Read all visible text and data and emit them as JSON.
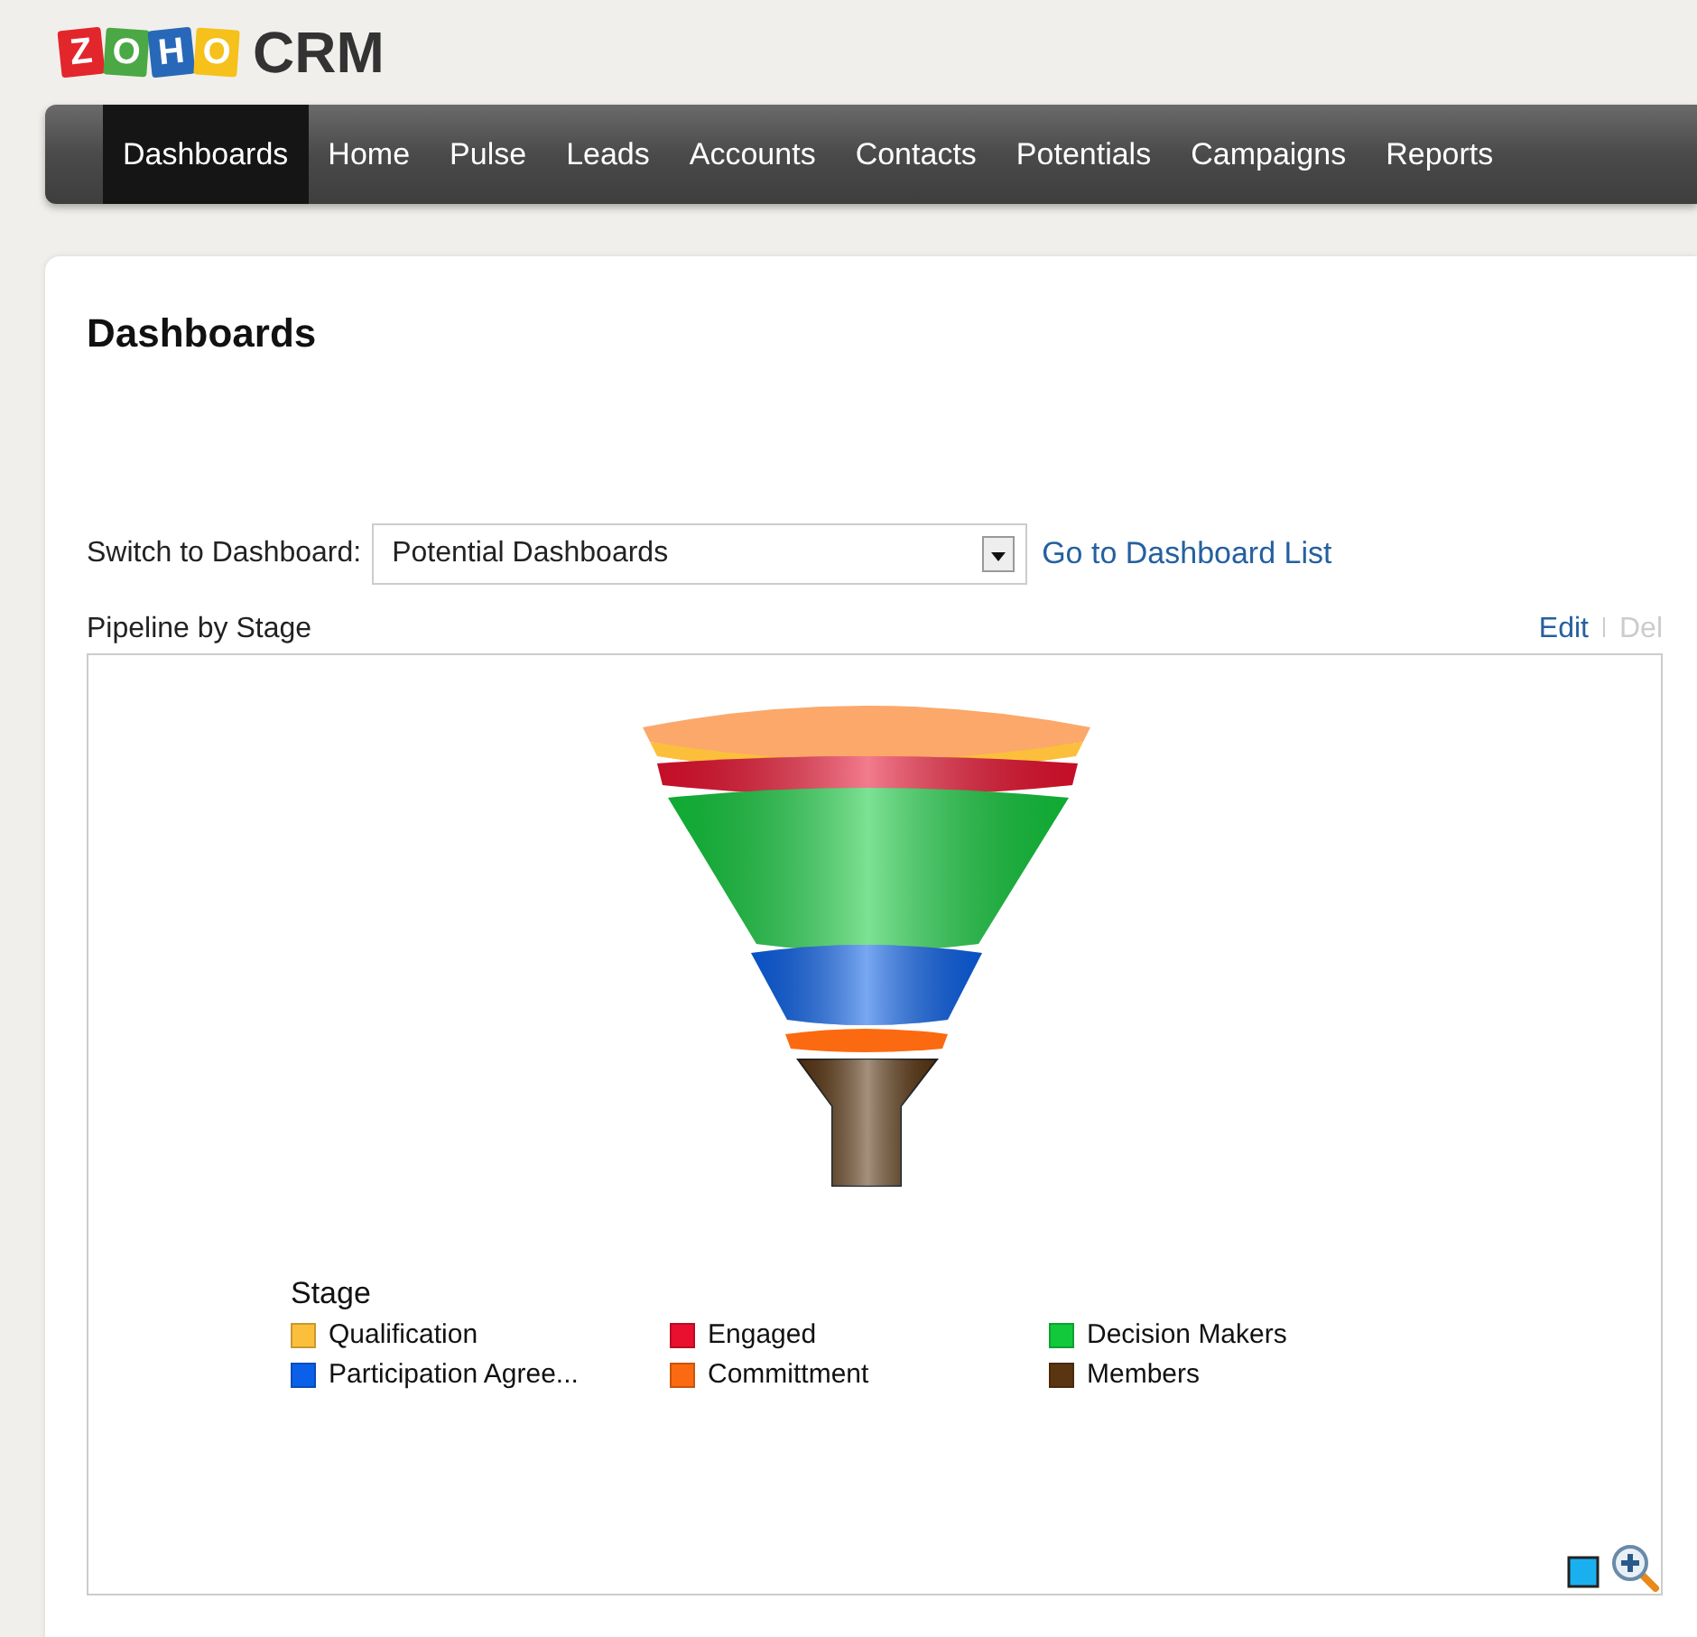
{
  "logo": {
    "letters": [
      "Z",
      "O",
      "H",
      "O"
    ],
    "product": "CRM"
  },
  "nav": [
    {
      "label": "Dashboards",
      "selected": true
    },
    {
      "label": "Home",
      "selected": false
    },
    {
      "label": "Pulse",
      "selected": false
    },
    {
      "label": "Leads",
      "selected": false
    },
    {
      "label": "Accounts",
      "selected": false
    },
    {
      "label": "Contacts",
      "selected": false
    },
    {
      "label": "Potentials",
      "selected": false
    },
    {
      "label": "Campaigns",
      "selected": false
    },
    {
      "label": "Reports",
      "selected": false
    }
  ],
  "page_title": "Dashboards",
  "switch": {
    "label": "Switch to Dashboard:",
    "value": "Potential Dashboards",
    "link": "Go to Dashboard List"
  },
  "panel": {
    "title": "Pipeline by Stage",
    "actions": [
      {
        "label": "Edit",
        "disabled": false
      },
      {
        "label": "Del",
        "disabled": true
      }
    ],
    "legend_title": "Stage",
    "legend": [
      {
        "label": "Qualification",
        "color": "#fcbf3c"
      },
      {
        "label": "Engaged",
        "color": "#e8102e"
      },
      {
        "label": "Decision Makers",
        "color": "#12c93c"
      },
      {
        "label": "Participation Agree...",
        "color": "#0a60e8"
      },
      {
        "label": "Committment",
        "color": "#fb6a10"
      },
      {
        "label": "Members",
        "color": "#5a3511"
      }
    ]
  }
}
